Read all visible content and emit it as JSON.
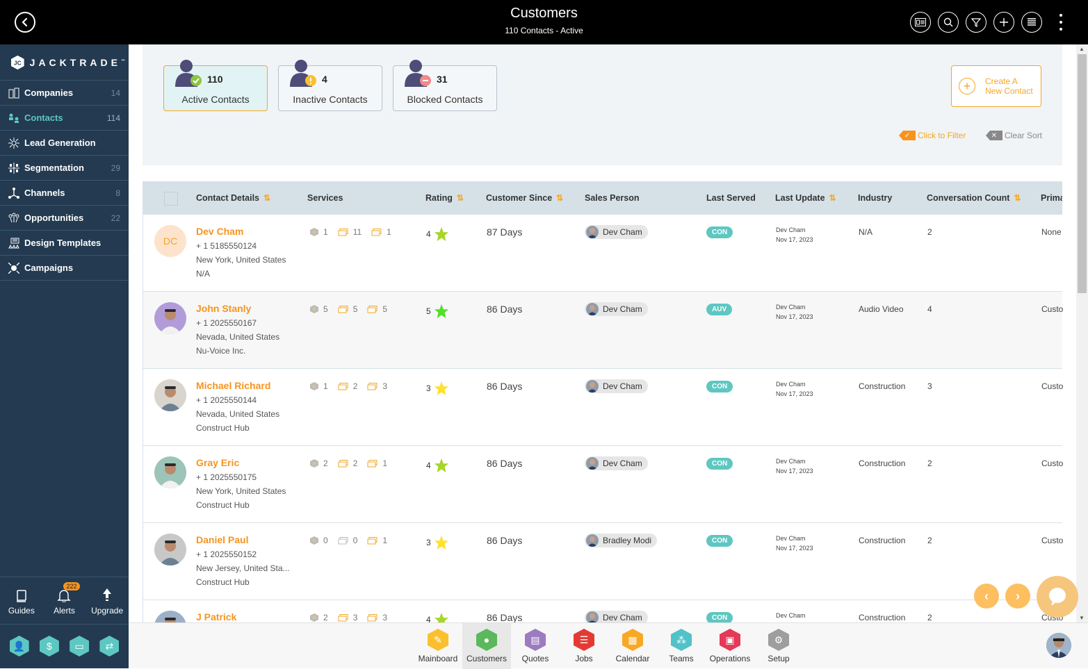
{
  "header": {
    "title": "Customers",
    "subtitle": "110 Contacts - Active",
    "actions": [
      "contact-card-icon",
      "search-icon",
      "filter-icon",
      "add-icon",
      "list-icon",
      "more-icon"
    ]
  },
  "sidebar": {
    "logo_text": "JACKTRADE",
    "logo_tm": "™",
    "items": [
      {
        "label": "Companies",
        "count": "14",
        "icon": "companies-icon"
      },
      {
        "label": "Contacts",
        "count": "114",
        "icon": "contacts-icon",
        "active": true
      },
      {
        "label": "Lead Generation",
        "count": "",
        "icon": "lead-generation-icon"
      },
      {
        "label": "Segmentation",
        "count": "29",
        "icon": "segmentation-icon"
      },
      {
        "label": "Channels",
        "count": "8",
        "icon": "channels-icon"
      },
      {
        "label": "Opportunities",
        "count": "22",
        "icon": "opportunities-icon"
      },
      {
        "label": "Design Templates",
        "count": "",
        "icon": "design-templates-icon"
      },
      {
        "label": "Campaigns",
        "count": "",
        "icon": "campaigns-icon"
      }
    ],
    "bottom": [
      {
        "label": "Guides",
        "icon": "book-icon"
      },
      {
        "label": "Alerts",
        "icon": "bell-icon",
        "badge": "222"
      },
      {
        "label": "Upgrade",
        "icon": "upgrade-arrow-icon"
      }
    ],
    "quick": [
      "person-icon",
      "dollar-icon",
      "money-icon",
      "workflow-icon"
    ]
  },
  "summary": {
    "cards": [
      {
        "count": "110",
        "label": "Active Contacts",
        "status": "active"
      },
      {
        "count": "4",
        "label": "Inactive Contacts",
        "status": "inactive"
      },
      {
        "count": "31",
        "label": "Blocked Contacts",
        "status": "blocked"
      }
    ],
    "create_line1": "Create A",
    "create_line2": "New Contact",
    "filter_label": "Click to Filter",
    "clear_sort_label": "Clear Sort"
  },
  "table": {
    "columns": [
      "Contact Details",
      "Services",
      "Rating",
      "Customer Since",
      "Sales Person",
      "Last Served",
      "Last Update",
      "Industry",
      "Conversation Count",
      "Prima"
    ],
    "rows": [
      {
        "initials": "DC",
        "name": "Dev Cham",
        "phone": "+ 1 5185550124",
        "location": "New York, United States",
        "company": "N/A",
        "services": [
          "1",
          "11",
          "1"
        ],
        "rating": "4",
        "since": "87 Days",
        "sales_person": "Dev Cham",
        "served": "CON",
        "upd_by": "Dev Cham",
        "upd_date": "Nov 17, 2023",
        "industry": "N/A",
        "conv": "2",
        "primary": "None"
      },
      {
        "initials": "",
        "name": "John Stanly",
        "phone": "+ 1 2025550167",
        "location": "Nevada, United States",
        "company": "Nu-Voice Inc.",
        "services": [
          "5",
          "5",
          "5"
        ],
        "rating": "5",
        "since": "86 Days",
        "sales_person": "Dev Cham",
        "served": "AUV",
        "upd_by": "Dev Cham",
        "upd_date": "Nov 17, 2023",
        "industry": "Audio Video",
        "conv": "4",
        "primary": "Custo"
      },
      {
        "initials": "",
        "name": "Michael Richard",
        "phone": "+ 1 2025550144",
        "location": "Nevada, United States",
        "company": "Construct Hub",
        "services": [
          "1",
          "2",
          "3"
        ],
        "rating": "3",
        "since": "86 Days",
        "sales_person": "Dev Cham",
        "served": "CON",
        "upd_by": "Dev Cham",
        "upd_date": "Nov 17, 2023",
        "industry": "Construction",
        "conv": "3",
        "primary": "Custo"
      },
      {
        "initials": "",
        "name": "Gray Eric",
        "phone": "+ 1 2025550175",
        "location": "New York, United States",
        "company": "Construct Hub",
        "services": [
          "2",
          "2",
          "1"
        ],
        "rating": "4",
        "since": "86 Days",
        "sales_person": "Dev Cham",
        "served": "CON",
        "upd_by": "Dev Cham",
        "upd_date": "Nov 17, 2023",
        "industry": "Construction",
        "conv": "2",
        "primary": "Custo"
      },
      {
        "initials": "",
        "name": "Daniel Paul",
        "phone": "+ 1 2025550152",
        "location": "New Jersey, United Sta...",
        "company": "Construct Hub",
        "services": [
          "0",
          "0",
          "1"
        ],
        "rating": "3",
        "since": "86 Days",
        "sales_person": "Bradley Modi",
        "served": "CON",
        "upd_by": "Dev Cham",
        "upd_date": "Nov 17, 2023",
        "industry": "Construction",
        "conv": "2",
        "primary": "Custo"
      },
      {
        "initials": "",
        "name": "J Patrick",
        "phone": "",
        "location": "",
        "company": "",
        "services": [
          "2",
          "3",
          "3"
        ],
        "rating": "4",
        "since": "86 Days",
        "sales_person": "Dev Cham",
        "served": "CON",
        "upd_by": "Dev Cham",
        "upd_date": "",
        "industry": "Construction",
        "conv": "2",
        "primary": "Custo"
      }
    ]
  },
  "bottom_nav": [
    {
      "label": "Mainboard",
      "color": "#fbc02d",
      "glyph": "✎"
    },
    {
      "label": "Customers",
      "color": "#5cb85c",
      "glyph": "●",
      "active": true
    },
    {
      "label": "Quotes",
      "color": "#9c7bc0",
      "glyph": "▤"
    },
    {
      "label": "Jobs",
      "color": "#e53935",
      "glyph": "☰"
    },
    {
      "label": "Calendar",
      "color": "#f9a825",
      "glyph": "▦"
    },
    {
      "label": "Teams",
      "color": "#4fc3c7",
      "glyph": "⁂"
    },
    {
      "label": "Operations",
      "color": "#e53958",
      "glyph": "▣"
    },
    {
      "label": "Setup",
      "color": "#9e9e9e",
      "glyph": "⚙"
    }
  ],
  "colors": {
    "accent": "#f7941d",
    "teal": "#5ec7c2",
    "sidebar": "#233a50",
    "star_4": "#a6d62a",
    "star_5": "#52e02a",
    "star_3": "#ffe12e"
  }
}
